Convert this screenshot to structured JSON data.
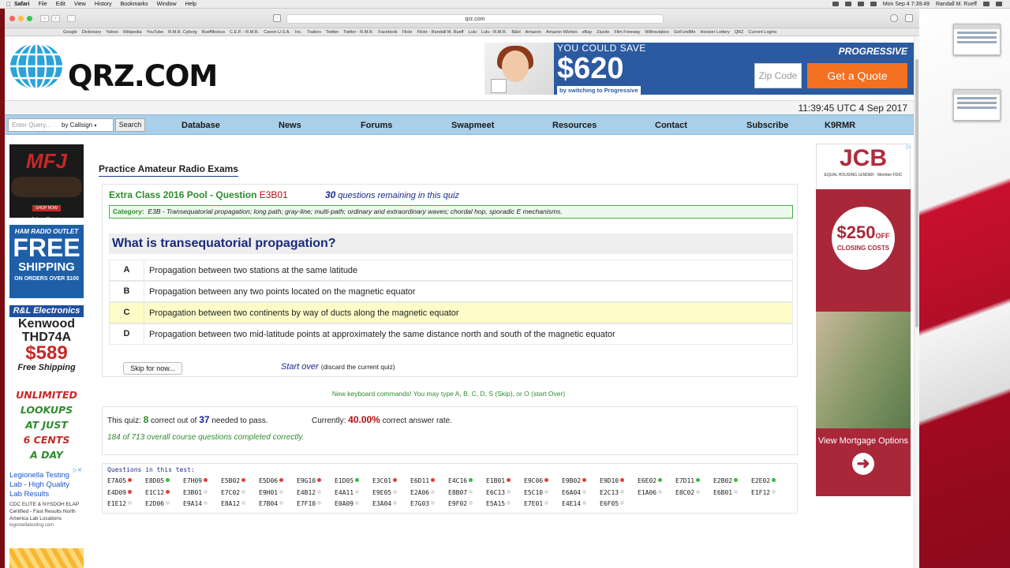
{
  "menubar": {
    "app": "Safari",
    "items": [
      "File",
      "Edit",
      "View",
      "History",
      "Bookmarks",
      "Window",
      "Help"
    ],
    "clock": "Mon Sep 4  7:39:49",
    "user": "Randall M. Rueff"
  },
  "browser": {
    "url": "qrz.com",
    "bookmarks": [
      "Google",
      "Dictionary",
      "Yahoo",
      "Wikipedia",
      "YouTube",
      "R.M.R. Cyborg",
      "Rueffilicious",
      "C.E.P. - R.M.R.",
      "Canon U.S.A.",
      "Inc.",
      "Trailers",
      "Twitter",
      "Twitter - R.M.R.",
      "Facebook",
      "Flickr",
      "Flickr - Randall M. Rueff",
      "Lulu",
      "Lulu - R.M.R.",
      "B&H",
      "Amazon",
      "Amazon Wishes",
      "eBay",
      "Zazzle",
      "Film Freeway",
      "Withoutabox",
      "GoFundMe",
      "Hoosier Lottery",
      "QRZ",
      "Current Logins"
    ]
  },
  "site": {
    "logo": "QRZ.COM",
    "datetime": "11:39:45 UTC 4 Sep 2017"
  },
  "ad_top": {
    "line1": "YOU COULD SAVE",
    "amount": "$620",
    "line3": "by switching to Progressive",
    "brand": "PROGRESSIVE",
    "zip_placeholder": "Zip Code",
    "cta": "Get a Quote"
  },
  "search": {
    "placeholder": "Enter Query...",
    "mode": "by Callsign",
    "button": "Search"
  },
  "nav": [
    "Database",
    "News",
    "Forums",
    "Swapmeet",
    "Resources",
    "Contact",
    "Subscribe",
    "K9RMR"
  ],
  "left_ads": {
    "mfj": "MFJ",
    "mfj_shop": "SHOP NOW",
    "gigaparts": "GigaParts",
    "ham": "HAM RADIO OUTLET",
    "free": "FREE",
    "shipping": "SHIPPING",
    "orders": "ON ORDERS OVER $100",
    "rl": "R&L Electronics",
    "kenwood": "Kenwood",
    "model": "THD74A",
    "price": "$589",
    "free_ship": "Free Shipping",
    "unlimited": [
      "UNLIMITED",
      "LOOKUPS",
      "AT JUST",
      "6 CENTS",
      "A DAY"
    ],
    "legionella_title": "Legionella Testing Lab - High Quality Lab Results",
    "legionella_body": "CDC ELITE & NYSDOH ELAP Certified - Fast Results North America Lab Locations",
    "legionella_url": "legionellatesting.com"
  },
  "right_ad": {
    "brand": "JCB",
    "equal": "EQUAL HOUSING LENDER",
    "fdic": "Member FDIC",
    "offer": "$250",
    "off": "OFF",
    "closing": "CLOSING COSTS",
    "mortgage": "View Mortgage Options"
  },
  "quiz": {
    "page_title": "Practice Amateur Radio Exams",
    "pool": "Extra Class 2016 Pool - Question",
    "code": "E3B01",
    "remaining": "30",
    "remaining_text": "questions remaining in this quiz",
    "category_label": "Category:",
    "category_text": "E3B - Transequatorial propagation; long path; gray-line; multi-path; ordinary and extraordinary waves; chordal hop, sporadic E mechanisms.",
    "question": "What is transequatorial propagation?",
    "answers": [
      {
        "letter": "A",
        "text": "Propagation between two stations at the same latitude"
      },
      {
        "letter": "B",
        "text": "Propagation between any two points located on the magnetic equator"
      },
      {
        "letter": "C",
        "text": "Propagation between two continents by way of ducts along the magnetic equator"
      },
      {
        "letter": "D",
        "text": "Propagation between two mid-latitude points at approximately the same distance north and south of the magnetic equator"
      }
    ],
    "skip": "Skip for now...",
    "start_over": "Start over",
    "start_over_note": "(discard the current quiz)",
    "keyboard": "New keyboard commands! You may type A, B, C, D, S (Skip), or O (start Over)",
    "stats": {
      "this_quiz": "This quiz:",
      "correct": "8",
      "correct_text": "correct out of",
      "needed": "37",
      "needed_text": "needed to pass.",
      "currently": "Currently:",
      "rate": "40.00%",
      "rate_text": "correct answer rate.",
      "overall": "184 of 713 overall course questions completed correctly."
    },
    "questions_header": "Questions in this test:",
    "questions": [
      [
        "E7A05",
        "r"
      ],
      [
        "E8D05",
        "g"
      ],
      [
        "E7H09",
        "r"
      ],
      [
        "E5B02",
        "r"
      ],
      [
        "E5D06",
        "r"
      ],
      [
        "E9G10",
        "r"
      ],
      [
        "E1D05",
        "g"
      ],
      [
        "E3C01",
        "r"
      ],
      [
        "E6D11",
        "r"
      ],
      [
        "E4C16",
        "g"
      ],
      [
        "E1B01",
        "r"
      ],
      [
        "E9C06",
        "r"
      ],
      [
        "E9B02",
        "r"
      ],
      [
        "E9D10",
        "r"
      ],
      [
        "E6E02",
        "g"
      ],
      [
        "E7D11",
        "g"
      ],
      [
        "E2B02",
        "g"
      ],
      [
        "E2E02",
        "g"
      ],
      [
        "E4D09",
        "r"
      ],
      [
        "E1C12",
        "r"
      ],
      [
        "E3B01",
        "n"
      ],
      [
        "E7C02",
        "n"
      ],
      [
        "E9H01",
        "n"
      ],
      [
        "E4B12",
        "n"
      ],
      [
        "E4A11",
        "n"
      ],
      [
        "E9E05",
        "n"
      ],
      [
        "E2A06",
        "n"
      ],
      [
        "E8B07",
        "n"
      ],
      [
        "E6C13",
        "n"
      ],
      [
        "E5C10",
        "n"
      ],
      [
        "E6A04",
        "n"
      ],
      [
        "E2C13",
        "n"
      ],
      [
        "E1A06",
        "n"
      ],
      [
        "E8C02",
        "n"
      ],
      [
        "E6B01",
        "n"
      ],
      [
        "E1F12",
        "n"
      ],
      [
        "E1E12",
        "n"
      ],
      [
        "E2D06",
        "n"
      ],
      [
        "E9A14",
        "n"
      ],
      [
        "E8A12",
        "n"
      ],
      [
        "E7B04",
        "n"
      ],
      [
        "E7F10",
        "n"
      ],
      [
        "E0A09",
        "n"
      ],
      [
        "E3A04",
        "n"
      ],
      [
        "E7G03",
        "n"
      ],
      [
        "E9F02",
        "n"
      ],
      [
        "E5A15",
        "n"
      ],
      [
        "E7E01",
        "n"
      ],
      [
        "E4E14",
        "n"
      ],
      [
        "E6F05",
        "n"
      ]
    ]
  },
  "colors": {
    "nav_bg": "#a9cfe9",
    "green": "#2e8b2e",
    "red": "#b01010",
    "blue": "#1a2a8a",
    "highlight": "#fdfcc8"
  }
}
